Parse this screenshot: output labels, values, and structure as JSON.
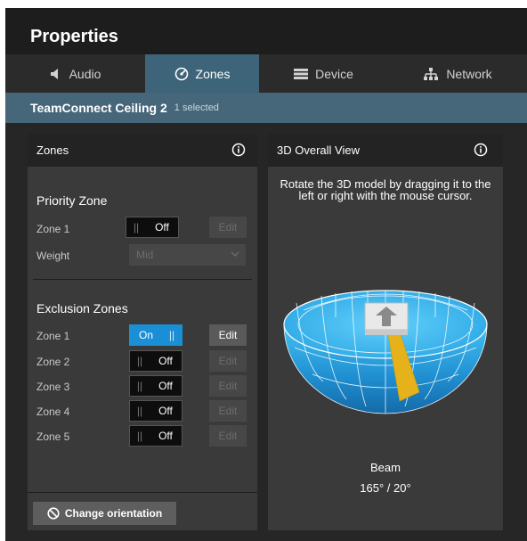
{
  "header": {
    "title": "Properties"
  },
  "tabs": [
    {
      "label": "Audio",
      "icon": "speaker-icon",
      "active": false
    },
    {
      "label": "Zones",
      "icon": "target-icon",
      "active": true
    },
    {
      "label": "Device",
      "icon": "device-icon",
      "active": false
    },
    {
      "label": "Network",
      "icon": "network-icon",
      "active": false
    }
  ],
  "device": {
    "name": "TeamConnect Ceiling 2",
    "selected": "1 selected"
  },
  "zones_panel": {
    "title": "Zones",
    "priority": {
      "title": "Priority Zone",
      "zone_label": "Zone 1",
      "zone_state": "Off",
      "edit_label": "Edit",
      "weight_label": "Weight",
      "weight_value": "Mid"
    },
    "exclusion": {
      "title": "Exclusion Zones",
      "zones": [
        {
          "label": "Zone 1",
          "state": "On",
          "edit": "Edit"
        },
        {
          "label": "Zone 2",
          "state": "Off",
          "edit": "Edit"
        },
        {
          "label": "Zone 3",
          "state": "Off",
          "edit": "Edit"
        },
        {
          "label": "Zone 4",
          "state": "Off",
          "edit": "Edit"
        },
        {
          "label": "Zone 5",
          "state": "Off",
          "edit": "Edit"
        }
      ]
    },
    "orientation_button": "Change orientation"
  },
  "view_panel": {
    "title": "3D Overall View",
    "instruction": "Rotate the 3D model by dragging it to the left or right with the mouse cursor.",
    "beam_label": "Beam",
    "beam_value": "165° / 20°"
  },
  "colors": {
    "accent": "#1a8fd6",
    "active_tab": "#3d6478",
    "device_bar": "#46667a",
    "beam": "#e5b21c",
    "dome": "#29a8e6"
  }
}
